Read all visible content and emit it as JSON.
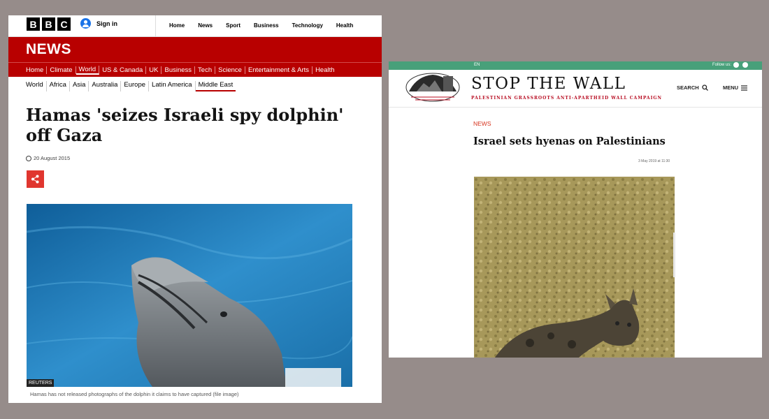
{
  "bbc": {
    "logo_letters": [
      "B",
      "B",
      "C"
    ],
    "sign_in": "Sign in",
    "top_nav": [
      "Home",
      "News",
      "Sport",
      "Business",
      "Technology",
      "Health"
    ],
    "section_title": "NEWS",
    "red_nav": [
      "Home",
      "Climate",
      "World",
      "US & Canada",
      "UK",
      "Business",
      "Tech",
      "Science",
      "Entertainment & Arts",
      "Health"
    ],
    "red_nav_selected": "World",
    "sub_nav": [
      "World",
      "Africa",
      "Asia",
      "Australia",
      "Europe",
      "Latin America",
      "Middle East"
    ],
    "sub_nav_selected": "Middle East",
    "headline": "Hamas 'seizes Israeli spy dolphin' off Gaza",
    "date": "20 August 2015",
    "image_credit": "REUTERS",
    "caption": "Hamas has not released photographs of the dolphin it claims to have captured (file image)",
    "brand_color": "#b80000",
    "share_icon": "share-icon",
    "clock_icon": "clock-icon"
  },
  "stw": {
    "language": "EN",
    "follow_us": "Follow us:",
    "social_icons": [
      "twitter-icon",
      "facebook-icon"
    ],
    "site_title": "STOP THE WALL",
    "tagline": "PALESTINIAN GRASSROOTS ANTI-APARTHEID WALL CAMPAIGN",
    "search_label": "SEARCH",
    "menu_label": "MENU",
    "category": "NEWS",
    "headline": "Israel sets hyenas on Palestinians",
    "date": "3 May 2019 at 11:30",
    "accent_color": "#48a07a",
    "tagline_color": "#b80d22"
  }
}
